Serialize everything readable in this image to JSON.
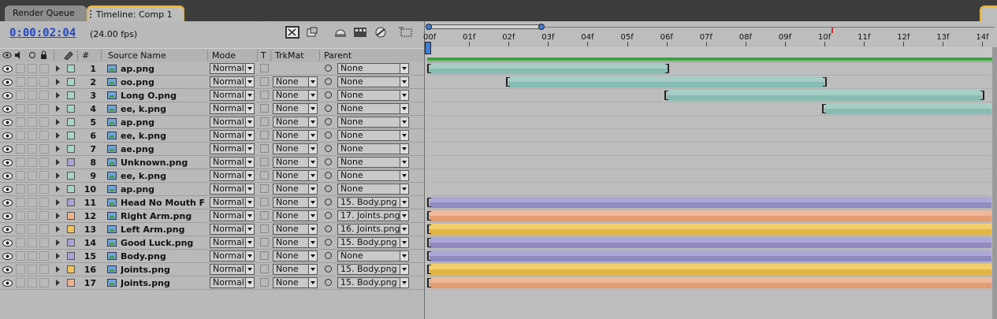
{
  "tabs": {
    "render_queue": "Render Queue",
    "timeline": "Timeline: Comp 1",
    "close": "×"
  },
  "toolbar": {
    "timecode": "0:00:02:04",
    "fps": "(24.00 fps)"
  },
  "headers": {
    "number": "#",
    "source": "Source Name",
    "mode": "Mode",
    "t": "T",
    "trkmat": "TrkMat",
    "parent": "Parent"
  },
  "ruler": [
    "00f",
    "01f",
    "02f",
    "03f",
    "04f",
    "05f",
    "06f",
    "07f",
    "08f",
    "09f",
    "10f",
    "11f",
    "12f",
    "13f",
    "14f"
  ],
  "layers": [
    {
      "num": "1",
      "name": "ap.png",
      "mode": "Normal",
      "trkmat": "",
      "parent": "None",
      "label": "#a9d6c7",
      "bar": [
        0,
        6
      ],
      "color": "teal"
    },
    {
      "num": "2",
      "name": "oo.png",
      "mode": "Normal",
      "trkmat": "None",
      "parent": "None",
      "label": "#a9d6c7",
      "bar": [
        2,
        10
      ],
      "color": "teal"
    },
    {
      "num": "3",
      "name": "Long O.png",
      "mode": "Normal",
      "trkmat": "None",
      "parent": "None",
      "label": "#a9d6c7",
      "bar": [
        6,
        14
      ],
      "color": "teal"
    },
    {
      "num": "4",
      "name": "ee, k.png",
      "mode": "Normal",
      "trkmat": "None",
      "parent": "None",
      "label": "#a9d6c7",
      "bar": [
        10,
        14.3
      ],
      "color": "teal"
    },
    {
      "num": "5",
      "name": "ap.png",
      "mode": "Normal",
      "trkmat": "None",
      "parent": "None",
      "label": "#a9d6c7",
      "bar": null,
      "color": "teal"
    },
    {
      "num": "6",
      "name": "ee, k.png",
      "mode": "Normal",
      "trkmat": "None",
      "parent": "None",
      "label": "#a9d6c7",
      "bar": null,
      "color": "teal"
    },
    {
      "num": "7",
      "name": "ae.png",
      "mode": "Normal",
      "trkmat": "None",
      "parent": "None",
      "label": "#a9d6c7",
      "bar": null,
      "color": "teal"
    },
    {
      "num": "8",
      "name": "Unknown.png",
      "mode": "Normal",
      "trkmat": "None",
      "parent": "None",
      "label": "#aaa3d3",
      "bar": null,
      "color": "lav"
    },
    {
      "num": "9",
      "name": "ee, k.png",
      "mode": "Normal",
      "trkmat": "None",
      "parent": "None",
      "label": "#a9d6c7",
      "bar": null,
      "color": "teal"
    },
    {
      "num": "10",
      "name": "ap.png",
      "mode": "Normal",
      "trkmat": "None",
      "parent": "None",
      "label": "#a9d6c7",
      "bar": null,
      "color": "teal"
    },
    {
      "num": "11",
      "name": "Head No Mouth Fo",
      "mode": "Normal",
      "trkmat": "None",
      "parent": "15. Body.png",
      "label": "#aaa3d3",
      "bar": [
        0,
        14.3
      ],
      "color": "lav"
    },
    {
      "num": "12",
      "name": "Right Arm.png",
      "mode": "Normal",
      "trkmat": "None",
      "parent": "17. Joints.png",
      "label": "#efb28f",
      "bar": [
        0,
        14.3
      ],
      "color": "peach"
    },
    {
      "num": "13",
      "name": "Left Arm.png",
      "mode": "Normal",
      "trkmat": "None",
      "parent": "16. Joints.png",
      "label": "#eec45c",
      "bar": [
        0,
        14.3
      ],
      "color": "yellow"
    },
    {
      "num": "14",
      "name": "Good Luck.png",
      "mode": "Normal",
      "trkmat": "None",
      "parent": "15. Body.png",
      "label": "#aaa3d3",
      "bar": [
        0,
        14.3
      ],
      "color": "lav"
    },
    {
      "num": "15",
      "name": "Body.png",
      "mode": "Normal",
      "trkmat": "None",
      "parent": "None",
      "label": "#aaa3d3",
      "bar": [
        0,
        14.3
      ],
      "color": "lav"
    },
    {
      "num": "16",
      "name": "Joints.png",
      "mode": "Normal",
      "trkmat": "None",
      "parent": "15. Body.png",
      "label": "#eec45c",
      "bar": [
        0,
        14.3
      ],
      "color": "yellow"
    },
    {
      "num": "17",
      "name": "Joints.png",
      "mode": "Normal",
      "trkmat": "None",
      "parent": "15. Body.png",
      "label": "#efb28f",
      "bar": [
        0,
        14.3
      ],
      "color": "peach"
    }
  ],
  "colors": {
    "teal_top": "#a6cec6",
    "teal_bot": "#86bcb1",
    "lav_top": "#aca8d6",
    "lav_bot": "#8f8ac0",
    "peach_top": "#efb898",
    "peach_bot": "#e29d73",
    "yellow_top": "#f2cf6e",
    "yellow_bot": "#e3b540",
    "timecode": "#2147c4",
    "work_area": "#3aa33c"
  }
}
